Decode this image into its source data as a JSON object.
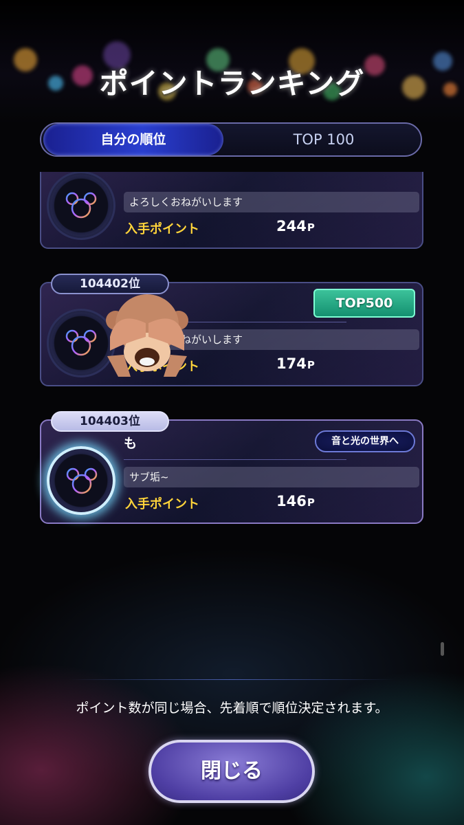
{
  "header": {
    "title": "ポイントランキング"
  },
  "tabs": [
    {
      "label": "自分の順位",
      "active": true
    },
    {
      "label": "TOP 100",
      "active": false
    }
  ],
  "rankings": [
    {
      "rank": "",
      "name": "",
      "comment": "よろしくおねがいします",
      "points_label": "入手ポイント",
      "points": "244",
      "unit": "P",
      "badge": ""
    },
    {
      "rank": "104402位",
      "name": "",
      "comment": "よろしくおねがいします",
      "points_label": "入手ポイント",
      "points": "174",
      "unit": "P",
      "badge": "TOP500"
    },
    {
      "rank": "104403位",
      "name": "も",
      "comment": "サブ垢~",
      "points_label": "入手ポイント",
      "points": "146",
      "unit": "P",
      "badge": "音と光の世界へ",
      "is_self": true
    }
  ],
  "footer": {
    "note": "ポイント数が同じ場合、先着順で順位決定されます。",
    "close_label": "閉じる"
  },
  "colors": {
    "points_label": "#ffd43a",
    "accent_blue": "#2a3fd0",
    "close_button": "#6a5ac0"
  }
}
